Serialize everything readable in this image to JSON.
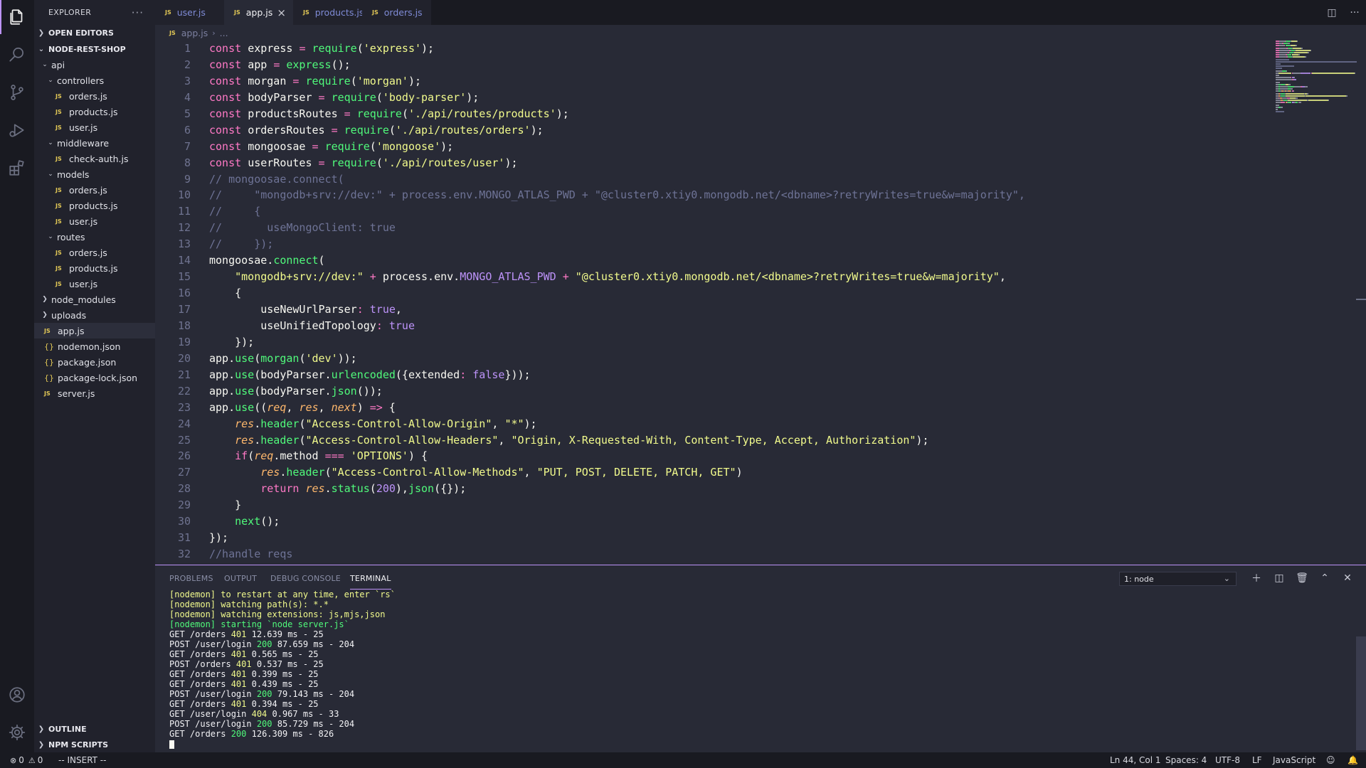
{
  "activity": {
    "items": [
      {
        "name": "explorer-icon",
        "top": 0
      },
      {
        "name": "search-icon"
      },
      {
        "name": "source-control-icon"
      },
      {
        "name": "run-debug-icon"
      },
      {
        "name": "extensions-icon"
      }
    ]
  },
  "sidebar": {
    "title": "EXPLORER",
    "more": "···",
    "open_editors": "OPEN EDITORS",
    "project": "NODE-REST-SHOP",
    "outline": "OUTLINE",
    "npm_scripts": "NPM SCRIPTS",
    "tree": [
      {
        "label": "api",
        "type": "folder",
        "open": true,
        "indent": 1
      },
      {
        "label": "controllers",
        "type": "folder",
        "open": true,
        "indent": 2
      },
      {
        "label": "orders.js",
        "type": "js",
        "indent": 3
      },
      {
        "label": "products.js",
        "type": "js",
        "indent": 3
      },
      {
        "label": "user.js",
        "type": "js",
        "indent": 3
      },
      {
        "label": "middleware",
        "type": "folder",
        "open": true,
        "indent": 2
      },
      {
        "label": "check-auth.js",
        "type": "js",
        "indent": 3
      },
      {
        "label": "models",
        "type": "folder",
        "open": true,
        "indent": 2
      },
      {
        "label": "orders.js",
        "type": "js",
        "indent": 3
      },
      {
        "label": "products.js",
        "type": "js",
        "indent": 3
      },
      {
        "label": "user.js",
        "type": "js",
        "indent": 3
      },
      {
        "label": "routes",
        "type": "folder",
        "open": true,
        "indent": 2
      },
      {
        "label": "orders.js",
        "type": "js",
        "indent": 3
      },
      {
        "label": "products.js",
        "type": "js",
        "indent": 3
      },
      {
        "label": "user.js",
        "type": "js",
        "indent": 3
      },
      {
        "label": "node_modules",
        "type": "folder",
        "open": false,
        "indent": 1
      },
      {
        "label": "uploads",
        "type": "folder",
        "open": false,
        "indent": 1
      },
      {
        "label": "app.js",
        "type": "js",
        "indent": 1,
        "selected": true
      },
      {
        "label": "nodemon.json",
        "type": "json",
        "indent": 1
      },
      {
        "label": "package.json",
        "type": "json",
        "indent": 1
      },
      {
        "label": "package-lock.json",
        "type": "json",
        "indent": 1
      },
      {
        "label": "server.js",
        "type": "js",
        "indent": 1
      }
    ]
  },
  "tabs": [
    {
      "label": "user.js",
      "active": false
    },
    {
      "label": "app.js",
      "active": true
    },
    {
      "label": "products.js",
      "active": false
    },
    {
      "label": "orders.js",
      "active": false
    }
  ],
  "file_badge": "JS",
  "close_glyph": "×",
  "breadcrumb": {
    "file": "app.js",
    "sep": "›",
    "rest": "..."
  },
  "editor": {
    "lines": [
      [
        [
          "k",
          "const "
        ],
        [
          "v",
          "express "
        ],
        [
          "k",
          "= "
        ],
        [
          "f",
          "require"
        ],
        [
          "v",
          "("
        ],
        [
          "s",
          "'express'"
        ],
        [
          "v",
          ");"
        ]
      ],
      [
        [
          "k",
          "const "
        ],
        [
          "v",
          "app "
        ],
        [
          "k",
          "= "
        ],
        [
          "f",
          "express"
        ],
        [
          "v",
          "();"
        ]
      ],
      [
        [
          "k",
          "const "
        ],
        [
          "v",
          "morgan "
        ],
        [
          "k",
          "= "
        ],
        [
          "f",
          "require"
        ],
        [
          "v",
          "("
        ],
        [
          "s",
          "'morgan'"
        ],
        [
          "v",
          ");"
        ]
      ],
      [
        [
          "k",
          "const "
        ],
        [
          "v",
          "bodyParser "
        ],
        [
          "k",
          "= "
        ],
        [
          "f",
          "require"
        ],
        [
          "v",
          "("
        ],
        [
          "s",
          "'body-parser'"
        ],
        [
          "v",
          ");"
        ]
      ],
      [
        [
          "k",
          "const "
        ],
        [
          "v",
          "productsRoutes "
        ],
        [
          "k",
          "= "
        ],
        [
          "f",
          "require"
        ],
        [
          "v",
          "("
        ],
        [
          "s",
          "'./api/routes/products'"
        ],
        [
          "v",
          ");"
        ]
      ],
      [
        [
          "k",
          "const "
        ],
        [
          "v",
          "ordersRoutes "
        ],
        [
          "k",
          "= "
        ],
        [
          "f",
          "require"
        ],
        [
          "v",
          "("
        ],
        [
          "s",
          "'./api/routes/orders'"
        ],
        [
          "v",
          ");"
        ]
      ],
      [
        [
          "k",
          "const "
        ],
        [
          "v",
          "mongoosae "
        ],
        [
          "k",
          "= "
        ],
        [
          "f",
          "require"
        ],
        [
          "v",
          "("
        ],
        [
          "s",
          "'mongoose'"
        ],
        [
          "v",
          ");"
        ]
      ],
      [
        [
          "k",
          "const "
        ],
        [
          "v",
          "userRoutes "
        ],
        [
          "k",
          "= "
        ],
        [
          "f",
          "require"
        ],
        [
          "v",
          "("
        ],
        [
          "s",
          "'./api/routes/user'"
        ],
        [
          "v",
          ");"
        ]
      ],
      [
        [
          "c",
          "// mongoosae.connect("
        ]
      ],
      [
        [
          "c",
          "//     \"mongodb+srv://dev:\" + process.env.MONGO_ATLAS_PWD + \"@cluster0.xtiy0.mongodb.net/<dbname>?retryWrites=true&w=majority\","
        ]
      ],
      [
        [
          "c",
          "//     {"
        ]
      ],
      [
        [
          "c",
          "//       useMongoClient: true"
        ]
      ],
      [
        [
          "c",
          "//     });"
        ]
      ],
      [
        [
          "v",
          "mongoosae."
        ],
        [
          "f",
          "connect"
        ],
        [
          "v",
          "("
        ]
      ],
      [
        [
          "v",
          "    "
        ],
        [
          "s",
          "\"mongodb+srv://dev:\" "
        ],
        [
          "k",
          "+ "
        ],
        [
          "v",
          "process.env."
        ],
        [
          "b",
          "MONGO_ATLAS_PWD "
        ],
        [
          "k",
          "+ "
        ],
        [
          "s",
          "\"@cluster0.xtiy0.mongodb.net/<dbname>?retryWrites=true&w=majority\""
        ],
        [
          "v",
          ","
        ]
      ],
      [
        [
          "v",
          "    {"
        ]
      ],
      [
        [
          "v",
          "        useNewUrlParser"
        ],
        [
          "k",
          ": "
        ],
        [
          "b",
          "true"
        ],
        [
          "v",
          ","
        ]
      ],
      [
        [
          "v",
          "        useUnifiedTopology"
        ],
        [
          "k",
          ": "
        ],
        [
          "b",
          "true"
        ]
      ],
      [
        [
          "v",
          "    });"
        ]
      ],
      [
        [
          "v",
          "app."
        ],
        [
          "f",
          "use"
        ],
        [
          "v",
          "("
        ],
        [
          "f",
          "morgan"
        ],
        [
          "v",
          "("
        ],
        [
          "s",
          "'dev'"
        ],
        [
          "v",
          "));"
        ]
      ],
      [
        [
          "v",
          "app."
        ],
        [
          "f",
          "use"
        ],
        [
          "v",
          "(bodyParser."
        ],
        [
          "f",
          "urlencoded"
        ],
        [
          "v",
          "({extended"
        ],
        [
          "k",
          ": "
        ],
        [
          "b",
          "false"
        ],
        [
          "v",
          "}));"
        ]
      ],
      [
        [
          "v",
          "app."
        ],
        [
          "f",
          "use"
        ],
        [
          "v",
          "(bodyParser."
        ],
        [
          "f",
          "json"
        ],
        [
          "v",
          "());"
        ]
      ],
      [
        [
          "v",
          "app."
        ],
        [
          "f",
          "use"
        ],
        [
          "v",
          "(("
        ],
        [
          "p",
          "req"
        ],
        [
          "v",
          ", "
        ],
        [
          "p",
          "res"
        ],
        [
          "v",
          ", "
        ],
        [
          "p",
          "next"
        ],
        [
          "v",
          ") "
        ],
        [
          "k",
          "=> "
        ],
        [
          "v",
          "{"
        ]
      ],
      [
        [
          "v",
          "    "
        ],
        [
          "p",
          "res"
        ],
        [
          "v",
          "."
        ],
        [
          "f",
          "header"
        ],
        [
          "v",
          "("
        ],
        [
          "s",
          "\"Access-Control-Allow-Origin\""
        ],
        [
          "v",
          ", "
        ],
        [
          "s",
          "\"*\""
        ],
        [
          "v",
          ");"
        ]
      ],
      [
        [
          "v",
          "    "
        ],
        [
          "p",
          "res"
        ],
        [
          "v",
          "."
        ],
        [
          "f",
          "header"
        ],
        [
          "v",
          "("
        ],
        [
          "s",
          "\"Access-Control-Allow-Headers\""
        ],
        [
          "v",
          ", "
        ],
        [
          "s",
          "\"Origin, X-Requested-With, Content-Type, Accept, Authorization\""
        ],
        [
          "v",
          ");"
        ]
      ],
      [
        [
          "v",
          "    "
        ],
        [
          "k",
          "if"
        ],
        [
          "v",
          "("
        ],
        [
          "p",
          "req"
        ],
        [
          "v",
          ".method "
        ],
        [
          "k",
          "=== "
        ],
        [
          "s",
          "'OPTIONS'"
        ],
        [
          "v",
          ") {"
        ]
      ],
      [
        [
          "v",
          "        "
        ],
        [
          "p",
          "res"
        ],
        [
          "v",
          "."
        ],
        [
          "f",
          "header"
        ],
        [
          "v",
          "("
        ],
        [
          "s",
          "\"Access-Control-Allow-Methods\""
        ],
        [
          "v",
          ", "
        ],
        [
          "s",
          "\"PUT, POST, DELETE, PATCH, GET\""
        ],
        [
          "v",
          ")"
        ]
      ],
      [
        [
          "v",
          "        "
        ],
        [
          "k",
          "return "
        ],
        [
          "p",
          "res"
        ],
        [
          "v",
          "."
        ],
        [
          "f",
          "status"
        ],
        [
          "v",
          "("
        ],
        [
          "b",
          "200"
        ],
        [
          "v",
          "),"
        ],
        [
          "f",
          "json"
        ],
        [
          "v",
          "({});"
        ]
      ],
      [
        [
          "v",
          "    }"
        ]
      ],
      [
        [
          "v",
          "    "
        ],
        [
          "f",
          "next"
        ],
        [
          "v",
          "();"
        ]
      ],
      [
        [
          "v",
          "});"
        ]
      ],
      [
        [
          "c",
          "//handle reqs"
        ]
      ]
    ]
  },
  "panel": {
    "tabs": [
      "PROBLEMS",
      "OUTPUT",
      "DEBUG CONSOLE",
      "TERMINAL"
    ],
    "active_tab": "TERMINAL",
    "terminal_select": "1: node",
    "terminal_lines": [
      [
        [
          "y",
          "[nodemon] to restart at any time, enter `rs`"
        ]
      ],
      [
        [
          "y",
          "[nodemon] watching path(s): *.*"
        ]
      ],
      [
        [
          "y",
          "[nodemon] watching extensions: js,mjs,json"
        ]
      ],
      [
        [
          "g",
          "[nodemon] starting `node server.js`"
        ]
      ],
      [
        [
          "w",
          "GET /orders "
        ],
        [
          "y",
          "401"
        ],
        [
          "w",
          " 12.639 ms - 25"
        ]
      ],
      [
        [
          "w",
          "POST /user/login "
        ],
        [
          "g",
          "200"
        ],
        [
          "w",
          " 87.659 ms - 204"
        ]
      ],
      [
        [
          "w",
          "GET /orders "
        ],
        [
          "y",
          "401"
        ],
        [
          "w",
          " 0.565 ms - 25"
        ]
      ],
      [
        [
          "w",
          "POST /orders "
        ],
        [
          "y",
          "401"
        ],
        [
          "w",
          " 0.537 ms - 25"
        ]
      ],
      [
        [
          "w",
          "GET /orders "
        ],
        [
          "y",
          "401"
        ],
        [
          "w",
          " 0.399 ms - 25"
        ]
      ],
      [
        [
          "w",
          "GET /orders "
        ],
        [
          "y",
          "401"
        ],
        [
          "w",
          " 0.439 ms - 25"
        ]
      ],
      [
        [
          "w",
          "POST /user/login "
        ],
        [
          "g",
          "200"
        ],
        [
          "w",
          " 79.143 ms - 204"
        ]
      ],
      [
        [
          "w",
          "GET /orders "
        ],
        [
          "y",
          "401"
        ],
        [
          "w",
          " 0.394 ms - 25"
        ]
      ],
      [
        [
          "w",
          "GET /user/login "
        ],
        [
          "y",
          "404"
        ],
        [
          "w",
          " 0.967 ms - 33"
        ]
      ],
      [
        [
          "w",
          "POST /user/login "
        ],
        [
          "g",
          "200"
        ],
        [
          "w",
          " 85.729 ms - 204"
        ]
      ],
      [
        [
          "w",
          "GET /orders "
        ],
        [
          "g",
          "200"
        ],
        [
          "w",
          " 126.309 ms - 826"
        ]
      ]
    ]
  },
  "status": {
    "errors": "0",
    "warnings": "0",
    "mode": "-- INSERT --",
    "position": "Ln 44, Col 1",
    "spaces": "Spaces: 4",
    "encoding": "UTF-8",
    "eol": "LF",
    "language": "JavaScript"
  },
  "colors": {
    "accent": "#bd93f9",
    "keyword": "#ff79c6",
    "function": "#50fa7b",
    "string": "#f1fa8c",
    "comment": "#6e7396",
    "constant": "#bd93f9",
    "param": "#ffb86c"
  }
}
